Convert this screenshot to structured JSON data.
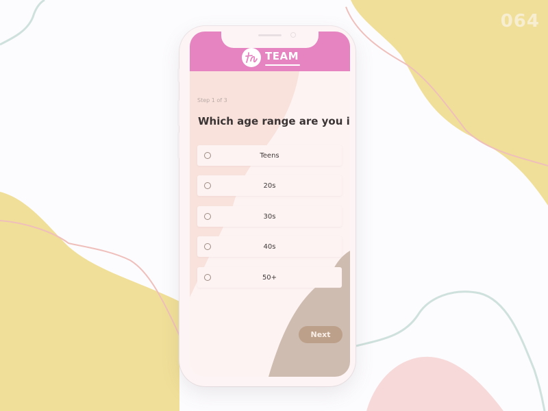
{
  "shot_number": "064",
  "brand": {
    "name": "TEAM",
    "monogram": "tr"
  },
  "colors": {
    "header": "#e584c0",
    "accent_button": "#bca08a",
    "background_yellow": "#f0df98",
    "background_pink": "#f7d9da",
    "line_teal": "#cfe1dc",
    "line_pink": "#efbfbb"
  },
  "survey": {
    "step_label": "Step 1 of 3",
    "question": "Which age range are you in?",
    "options": [
      {
        "label": "Teens",
        "selected": false
      },
      {
        "label": "20s",
        "selected": false
      },
      {
        "label": "30s",
        "selected": false
      },
      {
        "label": "40s",
        "selected": false
      },
      {
        "label": "50+",
        "selected": false
      }
    ],
    "next_label": "Next"
  }
}
